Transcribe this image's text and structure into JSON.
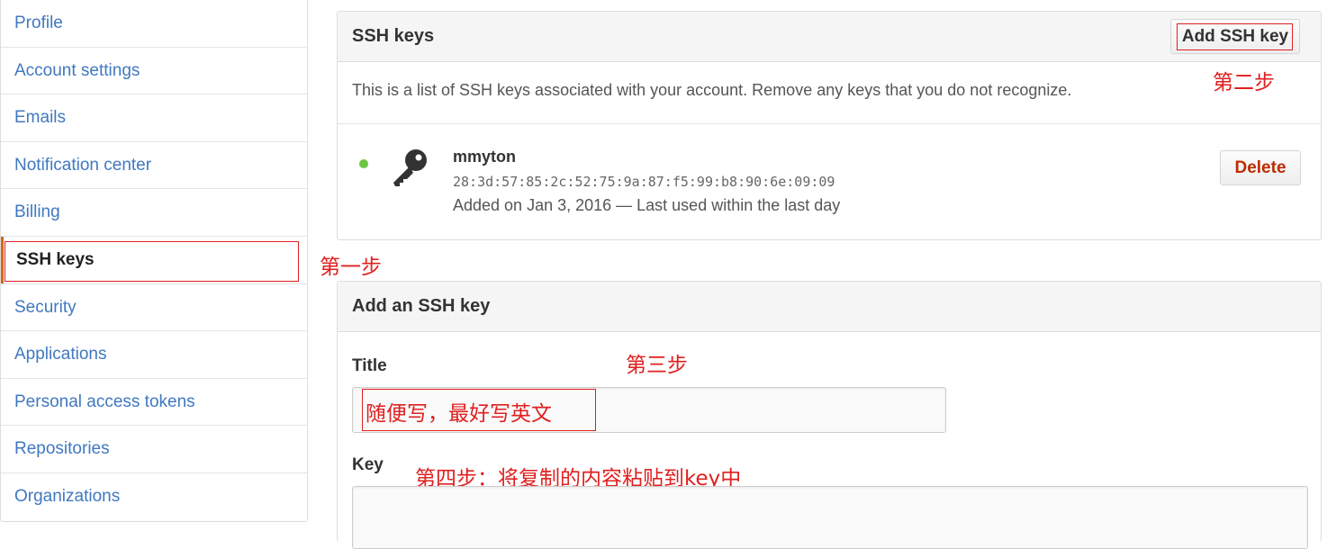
{
  "sidebar": {
    "items": [
      {
        "label": "Profile"
      },
      {
        "label": "Account settings"
      },
      {
        "label": "Emails"
      },
      {
        "label": "Notification center"
      },
      {
        "label": "Billing"
      },
      {
        "label": "SSH keys",
        "selected": true
      },
      {
        "label": "Security"
      },
      {
        "label": "Applications"
      },
      {
        "label": "Personal access tokens"
      },
      {
        "label": "Repositories"
      },
      {
        "label": "Organizations"
      }
    ]
  },
  "ssh_keys": {
    "title": "SSH keys",
    "add_button": "Add SSH key",
    "description": "This is a list of SSH keys associated with your account. Remove any keys that you do not recognize.",
    "key": {
      "name": "mmyton",
      "fingerprint": "28:3d:57:85:2c:52:75:9a:87:f5:99:b8:90:6e:09:09",
      "meta": "Added on Jan 3, 2016 — Last used within the last day",
      "delete_button": "Delete",
      "status_color": "#6cc644"
    }
  },
  "add_key": {
    "title": "Add an SSH key",
    "title_label": "Title",
    "title_value": "随便写，最好写英文",
    "key_label": "Key",
    "key_value": ""
  },
  "annotations": {
    "step1": "第一步",
    "step2": "第二步",
    "step3": "第三步",
    "step4": "第四步：将复制的内容粘贴到key中",
    "color": "#e02020"
  },
  "colors": {
    "link": "#4078c0",
    "selected_accent": "#d26911",
    "danger": "#bd2c00"
  }
}
